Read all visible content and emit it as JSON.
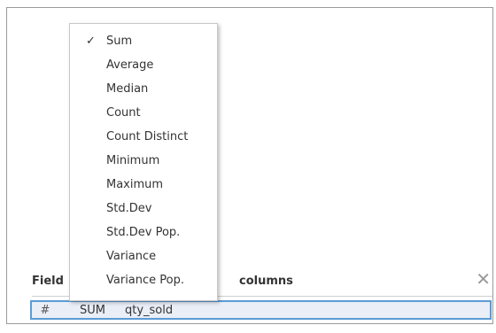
{
  "panel": {
    "field_title": "Field",
    "columns_title": "columns",
    "close_icon": "✕"
  },
  "pill": {
    "type_icon": "#",
    "aggregation": "SUM",
    "field_name": "qty_sold"
  },
  "menu": {
    "items": [
      {
        "label": "Sum",
        "checked": true,
        "check": "✓"
      },
      {
        "label": "Average",
        "checked": false
      },
      {
        "label": "Median",
        "checked": false
      },
      {
        "label": "Count",
        "checked": false
      },
      {
        "label": "Count Distinct",
        "checked": false
      },
      {
        "label": "Minimum",
        "checked": false
      },
      {
        "label": "Maximum",
        "checked": false
      },
      {
        "label": "Std.Dev",
        "checked": false
      },
      {
        "label": "Std.Dev Pop.",
        "checked": false
      },
      {
        "label": "Variance",
        "checked": false
      },
      {
        "label": "Variance Pop.",
        "checked": false
      }
    ]
  }
}
